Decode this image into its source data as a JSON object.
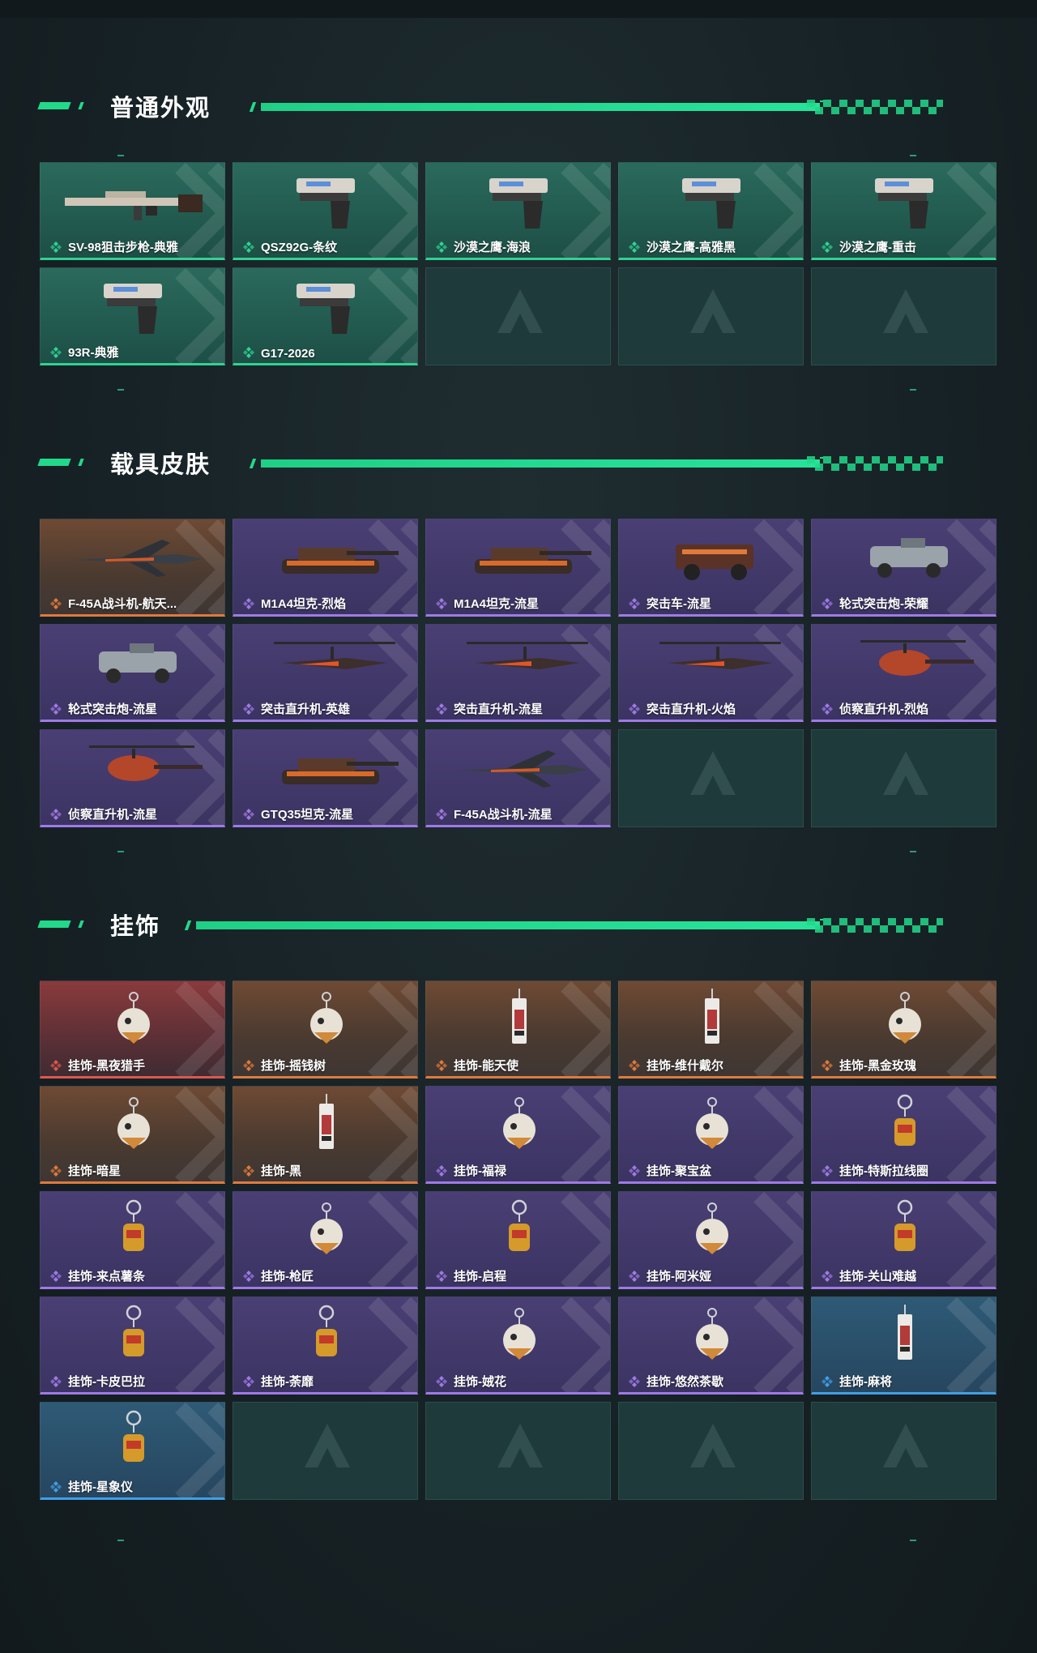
{
  "sections": [
    {
      "title": "普通外观",
      "items": [
        {
          "label": "SV-98狙击步枪-典雅",
          "rarity": "green",
          "icon": "sniper-rifle-icon"
        },
        {
          "label": "QSZ92G-条纹",
          "rarity": "green",
          "icon": "pistol-icon"
        },
        {
          "label": "沙漠之鹰-海浪",
          "rarity": "green",
          "icon": "pistol-icon"
        },
        {
          "label": "沙漠之鹰-高雅黑",
          "rarity": "green",
          "icon": "pistol-icon"
        },
        {
          "label": "沙漠之鹰-重击",
          "rarity": "green",
          "icon": "pistol-icon"
        },
        {
          "label": "93R-典雅",
          "rarity": "green",
          "icon": "pistol-icon"
        },
        {
          "label": "G17-2026",
          "rarity": "green",
          "icon": "pistol-icon"
        },
        {
          "empty": true
        },
        {
          "empty": true
        },
        {
          "empty": true
        }
      ]
    },
    {
      "title": "载具皮肤",
      "items": [
        {
          "label": "F-45A战斗机-航天...",
          "rarity": "gold",
          "icon": "jet-icon"
        },
        {
          "label": "M1A4坦克-烈焰",
          "rarity": "purple",
          "icon": "tank-icon"
        },
        {
          "label": "M1A4坦克-流星",
          "rarity": "purple",
          "icon": "tank-icon"
        },
        {
          "label": "突击车-流星",
          "rarity": "purple",
          "icon": "assault-vehicle-icon"
        },
        {
          "label": "轮式突击炮-荣耀",
          "rarity": "purple",
          "icon": "armored-car-icon"
        },
        {
          "label": "轮式突击炮-流星",
          "rarity": "purple",
          "icon": "armored-car-icon"
        },
        {
          "label": "突击直升机-英雄",
          "rarity": "purple",
          "icon": "attack-helicopter-icon"
        },
        {
          "label": "突击直升机-流星",
          "rarity": "purple",
          "icon": "attack-helicopter-icon"
        },
        {
          "label": "突击直升机-火焰",
          "rarity": "purple",
          "icon": "attack-helicopter-icon"
        },
        {
          "label": "侦察直升机-烈焰",
          "rarity": "purple",
          "icon": "scout-helicopter-icon"
        },
        {
          "label": "侦察直升机-流星",
          "rarity": "purple",
          "icon": "scout-helicopter-icon"
        },
        {
          "label": "GTQ35坦克-流星",
          "rarity": "purple",
          "icon": "tank-icon"
        },
        {
          "label": "F-45A战斗机-流星",
          "rarity": "purple",
          "icon": "jet-icon"
        },
        {
          "empty": true
        },
        {
          "empty": true
        }
      ]
    },
    {
      "title": "挂饰",
      "items": [
        {
          "label": "挂饰-黑夜猎手",
          "rarity": "red",
          "icon": "charm-icon"
        },
        {
          "label": "挂饰-摇钱树",
          "rarity": "gold",
          "icon": "charm-icon"
        },
        {
          "label": "挂饰-能天使",
          "rarity": "gold",
          "icon": "charm-tag-icon"
        },
        {
          "label": "挂饰-维什戴尔",
          "rarity": "gold",
          "icon": "charm-tag-icon"
        },
        {
          "label": "挂饰-黑金玫瑰",
          "rarity": "gold",
          "icon": "charm-icon"
        },
        {
          "label": "挂饰-暗星",
          "rarity": "gold",
          "icon": "charm-icon"
        },
        {
          "label": "挂饰-黑",
          "rarity": "gold",
          "icon": "charm-tag-icon"
        },
        {
          "label": "挂饰-福禄",
          "rarity": "purple",
          "icon": "charm-icon"
        },
        {
          "label": "挂饰-聚宝盆",
          "rarity": "purple",
          "icon": "charm-icon"
        },
        {
          "label": "挂饰-特斯拉线圈",
          "rarity": "purple",
          "icon": "charm-ring-icon"
        },
        {
          "label": "挂饰-来点薯条",
          "rarity": "purple",
          "icon": "charm-ring-icon"
        },
        {
          "label": "挂饰-枪匠",
          "rarity": "purple",
          "icon": "charm-icon"
        },
        {
          "label": "挂饰-启程",
          "rarity": "purple",
          "icon": "charm-ring-icon"
        },
        {
          "label": "挂饰-阿米娅",
          "rarity": "purple",
          "icon": "charm-icon"
        },
        {
          "label": "挂饰-关山难越",
          "rarity": "purple",
          "icon": "charm-ring-icon"
        },
        {
          "label": "挂饰-卡皮巴拉",
          "rarity": "purple",
          "icon": "charm-ring-icon"
        },
        {
          "label": "挂饰-荼靡",
          "rarity": "purple",
          "icon": "charm-ring-icon"
        },
        {
          "label": "挂饰-娀花",
          "rarity": "purple",
          "icon": "charm-icon"
        },
        {
          "label": "挂饰-悠然茶歇",
          "rarity": "purple",
          "icon": "charm-icon"
        },
        {
          "label": "挂饰-麻将",
          "rarity": "blue",
          "icon": "charm-tag-icon"
        },
        {
          "label": "挂饰-星象仪",
          "rarity": "blue",
          "icon": "charm-ring-icon"
        },
        {
          "empty": true
        },
        {
          "empty": true
        },
        {
          "empty": true
        },
        {
          "empty": true
        }
      ]
    }
  ],
  "colors": {
    "accent": "#22d98a",
    "green": "#2fd392",
    "gold": "#e07a3a",
    "purple": "#9f7ae6",
    "red": "#e1564c",
    "blue": "#3f9fe8"
  }
}
